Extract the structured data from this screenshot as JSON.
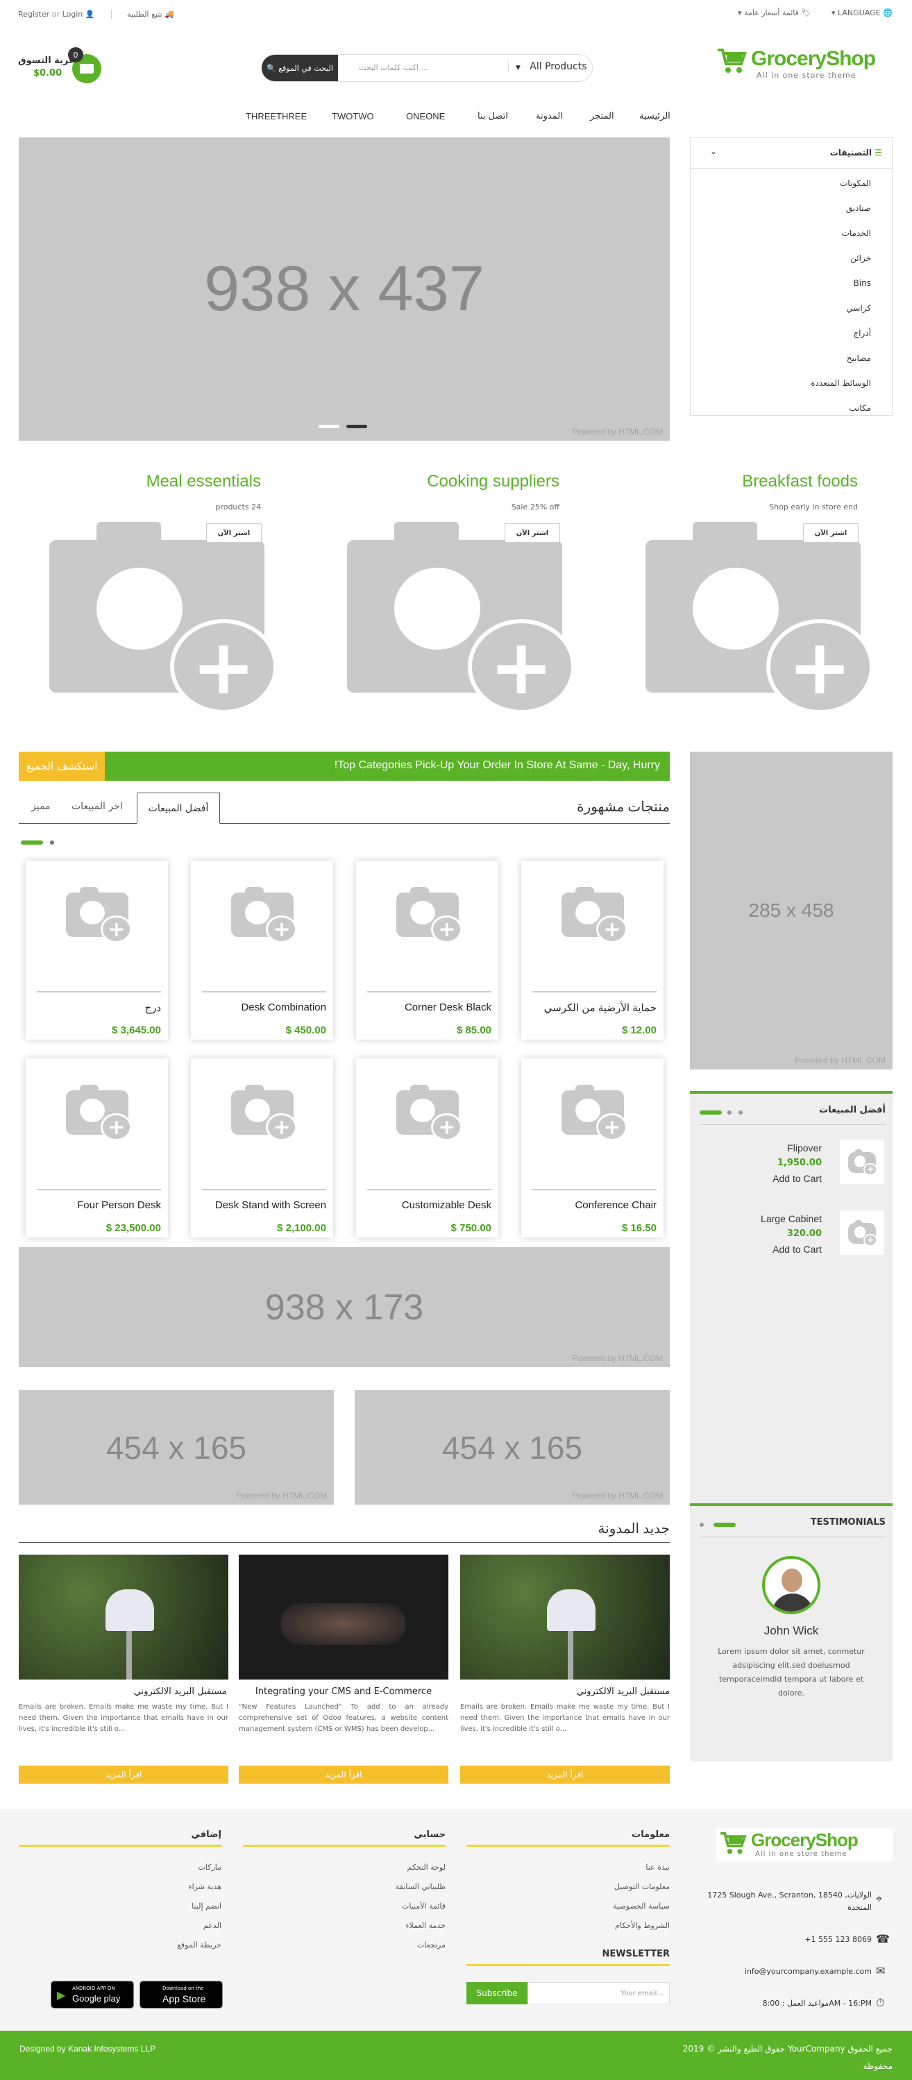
{
  "topbar": {
    "register": "Register",
    "or": "or",
    "login": "Login",
    "track": "تتبع الطلبية",
    "lang": "LANGUAGE",
    "pricelist": "قائمة أسعار عامة"
  },
  "header": {
    "logo_main": "GroceryShop",
    "logo_sub": "All in one store theme",
    "search_placeholder": "اكتب كلمات البحث ...",
    "category_select": "All Products",
    "search_button": "البحث في الموقع",
    "cart_title": "عربة التسوق",
    "cart_amount": "$0.00",
    "cart_count": "0"
  },
  "nav": [
    "الرئيسية",
    "المتجر",
    "المدونة",
    "اتصل بنا",
    "ONEONE",
    "TWOTWO",
    "THREETHREE"
  ],
  "categories": {
    "title": "التصنيفات",
    "items": [
      "المكونات",
      "صناديق",
      "الخدمات",
      "خزائن",
      "Bins",
      "كراسي",
      "أدراج",
      "مصابيح",
      "الوسائط المتعددة",
      "مكاتب"
    ]
  },
  "hero": {
    "label": "938 x 437",
    "powered": "Powered by HTML.COM"
  },
  "promos": [
    {
      "title": "Breakfast foods",
      "sub": "Shop early in store end",
      "btn": "اشتر الآن"
    },
    {
      "title": "Cooking suppliers",
      "sub": "Sale 25% off",
      "btn": "اشتر الآن"
    },
    {
      "title": "Meal essentials",
      "sub": "products 24",
      "btn": "اشتر الآن"
    }
  ],
  "banner": {
    "text": "!Top Categories Pick-Up Your Order In Store At Same - Day, Hurry",
    "btn": "استكشف الجميع"
  },
  "featured": {
    "title": "منتجات مشهورة",
    "tabs": [
      "أفضل المبيعات",
      "اخر المبيعات",
      "مميز"
    ]
  },
  "products": [
    {
      "name": "حماية الأرضية من الكرسي",
      "price": "$ 12.00"
    },
    {
      "name": "Corner Desk Black",
      "price": "$ 85.00"
    },
    {
      "name": "Desk Combination",
      "price": "$ 450.00"
    },
    {
      "name": "درج",
      "price": "$ 3,645.00"
    },
    {
      "name": "Conference Chair",
      "price": "$ 16.50"
    },
    {
      "name": "Customizable Desk",
      "price": "$ 750.00"
    },
    {
      "name": "Desk Stand with Screen",
      "price": "$ 2,100.00"
    },
    {
      "name": "Four Person Desk",
      "price": "$ 23,500.00"
    }
  ],
  "side_banner": {
    "label": "285 x 458",
    "powered": "Powered by HTML.COM"
  },
  "bestsellers": {
    "title": "أفضل المبيعات",
    "items": [
      {
        "name": "Flipover",
        "price": "1,950.00",
        "cta": "Add to Cart"
      },
      {
        "name": "Large Cabinet",
        "price": "320.00",
        "cta": "Add to Cart"
      }
    ]
  },
  "wide_banner": {
    "label": "938 x 173",
    "powered": "Powered by HTML.COM"
  },
  "half_banners": [
    {
      "label": "454 x 165",
      "powered": "Powered by HTML.COM"
    },
    {
      "label": "454 x 165",
      "powered": "Powered by HTML.COM"
    }
  ],
  "blog": {
    "title": "جديد المدونة",
    "posts": [
      {
        "title": "مستقبل البريد الالكتروني",
        "text": "Emails are broken. Emails make me waste my time. But I need them. Given the importance that emails have in our lives, it's incredible it's still o...",
        "btn": "اقرأ المزيد"
      },
      {
        "title": "Integrating your CMS and E-Commerce",
        "text": "\"New Features Launched\" To add to an already comprehensive set of Odoo features, a website content management system (CMS or WMS) has been develop...",
        "btn": "اقرأ المزيد"
      },
      {
        "title": "مستقبل البريد الالكتروني",
        "text": "Emails are broken. Emails make me waste my time. But I need them. Given the importance that emails have in our lives, it's incredible it's still o...",
        "btn": "اقرأ المزيد"
      }
    ]
  },
  "testimonials": {
    "title": "TESTIMONIALS",
    "name": "John Wick",
    "text": "Lorem ipsum dolor sit amet, conmetur adsipiscing elit,sed doeiusmod temporaceimdid tempora ut labore et dolore."
  },
  "footer": {
    "address": "1725 Slough Ave., Scranton, 18540 ,الولايات المتحدة",
    "phone": "+1 555 123 8069",
    "email": "info@yourcompany.example.com",
    "hours": "مواعيد العمل : 8:00AM - 16:PM",
    "info": {
      "title": "معلومات",
      "links": [
        "نبذة عنا",
        "معلومات التوصيل",
        "سياسة الخصوصية",
        "الشروط والأحكام"
      ]
    },
    "account": {
      "title": "حسابي",
      "links": [
        "لوحة التحكم",
        "طلبياتي السابقة",
        "قائمة الأمنيات",
        "خدمة العملاء",
        "مرتجعات"
      ]
    },
    "extra": {
      "title": "إضافي",
      "links": [
        "ماركات",
        "هدية شراء",
        "انضم إلينا",
        "الدعم",
        "خريطة الموقع"
      ]
    },
    "newsletter": {
      "title": "NEWSLETTER",
      "placeholder": "Your email...",
      "btn": "Subscribe"
    },
    "gplay": {
      "small": "ANDROID APP ON",
      "big": "Google play"
    },
    "appstore": {
      "small": "Download on the",
      "big": "App Store"
    }
  },
  "bottombar": {
    "copyright": "حقوق الطبع والنشر © 2019 YourCompany جميع الحقوق",
    "designed": "Designed by Kanak Infosystems LLP",
    "reserved": "محفوظة"
  }
}
